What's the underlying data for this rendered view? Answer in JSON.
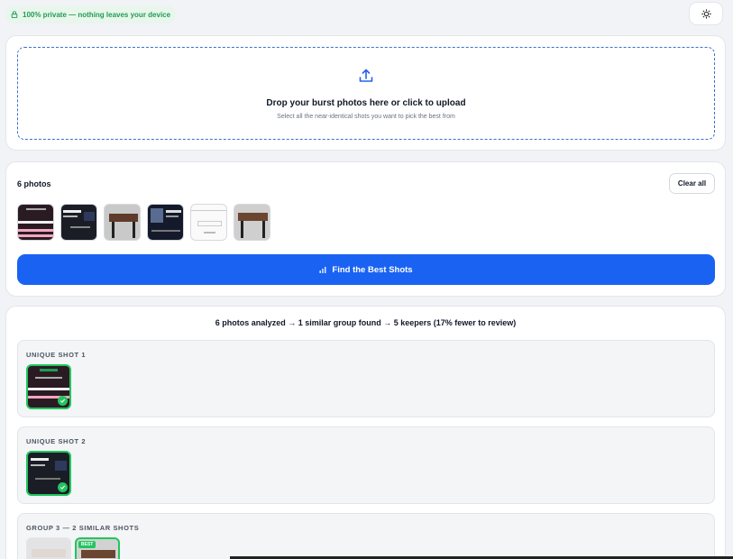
{
  "privacy_badge": "100% private — nothing leaves your device",
  "upload": {
    "title": "Drop your burst photos here or click to upload",
    "subtitle": "Select all the near-identical shots you want to pick the best from"
  },
  "photos": {
    "count_label": "6 photos",
    "clear_label": "Clear all",
    "find_label": "Find the Best Shots"
  },
  "results": {
    "summary": "6 photos analyzed → 1 similar group found → 5 keepers (17% fewer to review)",
    "groups": [
      {
        "title": "UNIQUE SHOT 1"
      },
      {
        "title": "UNIQUE SHOT 2"
      },
      {
        "title": "GROUP 3 — 2 SIMILAR SHOTS",
        "best_badge": "BEST"
      }
    ]
  },
  "colors": {
    "accent": "#1a63f2",
    "success": "#22c55e",
    "privacy_text": "#1f9d55"
  }
}
